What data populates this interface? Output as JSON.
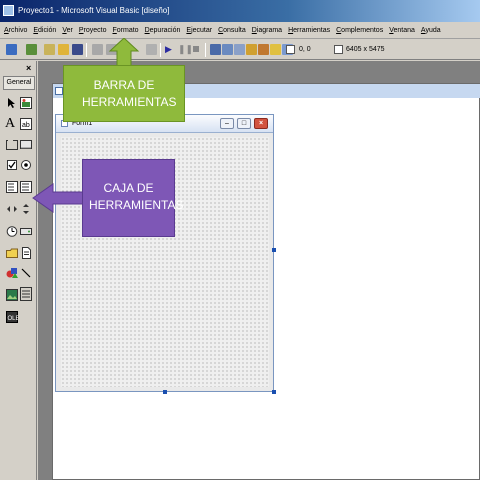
{
  "window": {
    "title": "Proyecto1 - Microsoft Visual Basic [diseño]"
  },
  "menu": {
    "items": [
      "Archivo",
      "Edición",
      "Ver",
      "Proyecto",
      "Formato",
      "Depuración",
      "Ejecutar",
      "Consulta",
      "Diagrama",
      "Herramientas",
      "Complementos",
      "Ventana",
      "Ayuda"
    ]
  },
  "toolbar": {
    "position_readout": "0, 0",
    "size_readout": "6405 x 5475"
  },
  "toolbox": {
    "close_label": "×",
    "tab_label": "General"
  },
  "form": {
    "caption": "Form1",
    "minimize_label": "–",
    "maximize_label": "□",
    "close_label": "×"
  },
  "annotations": {
    "toolbar_callout": "BARRA DE HERRAMIENTAS",
    "toolbox_callout": "CAJA DE HERRAMIENTAS"
  },
  "colors": {
    "green_callout": "#8fba3c",
    "purple_callout": "#7e57b6"
  }
}
